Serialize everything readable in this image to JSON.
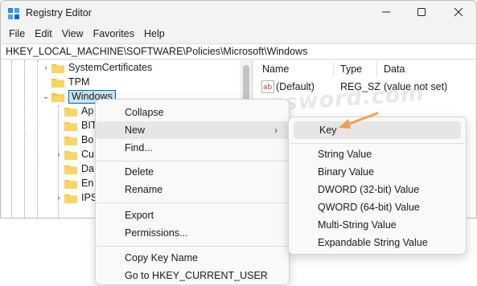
{
  "window": {
    "title": "Registry Editor",
    "minimize_icon": "minimize-icon",
    "maximize_icon": "maximize-icon",
    "close_icon": "close-icon"
  },
  "menubar": [
    "File",
    "Edit",
    "View",
    "Favorites",
    "Help"
  ],
  "address": "HKEY_LOCAL_MACHINE\\SOFTWARE\\Policies\\Microsoft\\Windows",
  "tree": {
    "items": [
      {
        "label": "SystemCertificates",
        "expander": ">"
      },
      {
        "label": "TPM",
        "expander": ""
      },
      {
        "label": "Windows",
        "expander": "v"
      },
      {
        "label": "Ap",
        "expander": ""
      },
      {
        "label": "BIT",
        "expander": ""
      },
      {
        "label": "Bo",
        "expander": ""
      },
      {
        "label": "Cu",
        "expander": ">"
      },
      {
        "label": "Da",
        "expander": ""
      },
      {
        "label": "En",
        "expander": ""
      },
      {
        "label": "IPS",
        "expander": ">"
      }
    ]
  },
  "list": {
    "columns": [
      "Name",
      "Type",
      "Data"
    ],
    "rows": [
      {
        "name": "(Default)",
        "type": "REG_SZ",
        "data": "(value not set)"
      }
    ]
  },
  "watermark": "top-password.com",
  "context_menu": {
    "items": [
      {
        "label": "Collapse"
      },
      {
        "label": "New",
        "submenu_arrow": ">"
      },
      {
        "label": "Find..."
      },
      {
        "label": "Delete"
      },
      {
        "label": "Rename"
      },
      {
        "label": "Export"
      },
      {
        "label": "Permissions..."
      },
      {
        "label": "Copy Key Name"
      },
      {
        "label": "Go to HKEY_CURRENT_USER"
      }
    ]
  },
  "submenu": {
    "items": [
      {
        "label": "Key"
      },
      {
        "label": "String Value"
      },
      {
        "label": "Binary Value"
      },
      {
        "label": "DWORD (32-bit) Value"
      },
      {
        "label": "QWORD (64-bit) Value"
      },
      {
        "label": "Multi-String Value"
      },
      {
        "label": "Expandable String Value"
      }
    ]
  },
  "colors": {
    "selection_border": "#0063b1",
    "selection_fill": "#cce4f7",
    "folder": "#f2c744",
    "annotation_arrow": "#f0a050"
  }
}
